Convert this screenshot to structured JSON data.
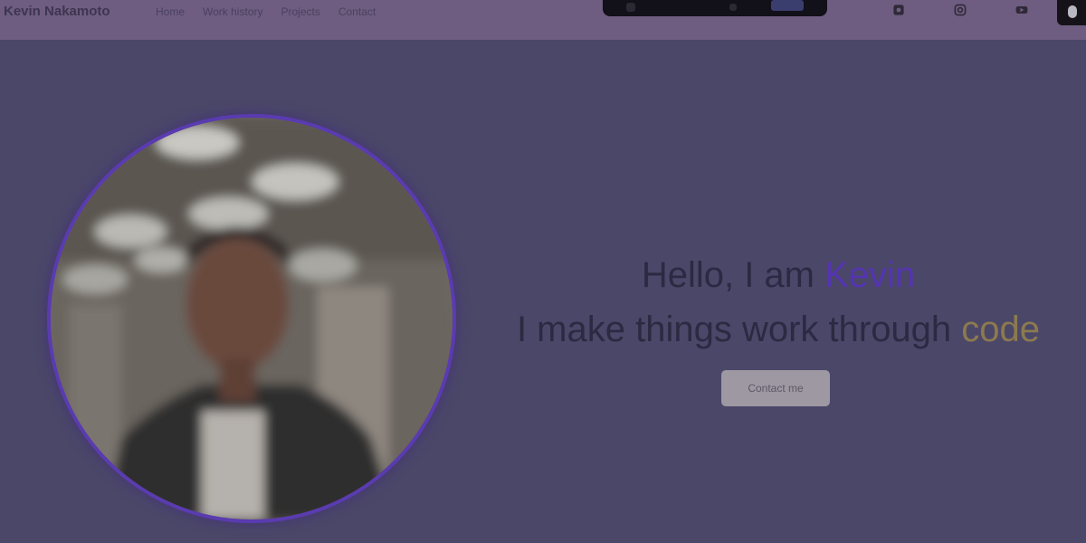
{
  "navbar": {
    "brand": "Kevin Nakamoto",
    "links": [
      "Home",
      "Work history",
      "Projects",
      "Contact"
    ]
  },
  "icons": {
    "top_right": [
      "github-icon",
      "instagram-icon",
      "youtube-icon",
      "user-icon"
    ],
    "photo": "profile-photo"
  },
  "hero": {
    "greeting_prefix": "Hello, I am ",
    "name": "Kevin",
    "tagline_prefix": "I make things work through ",
    "tagline_accent": "code",
    "button_label": "Contact me"
  },
  "colors": {
    "page_bg": "#4b4769",
    "navbar_bg": "#6e5d80",
    "name_accent": "#5434b0",
    "code_accent": "#8c7a4f",
    "photo_ring": "#5a3bb0",
    "button_bg": "#9d98a2"
  }
}
